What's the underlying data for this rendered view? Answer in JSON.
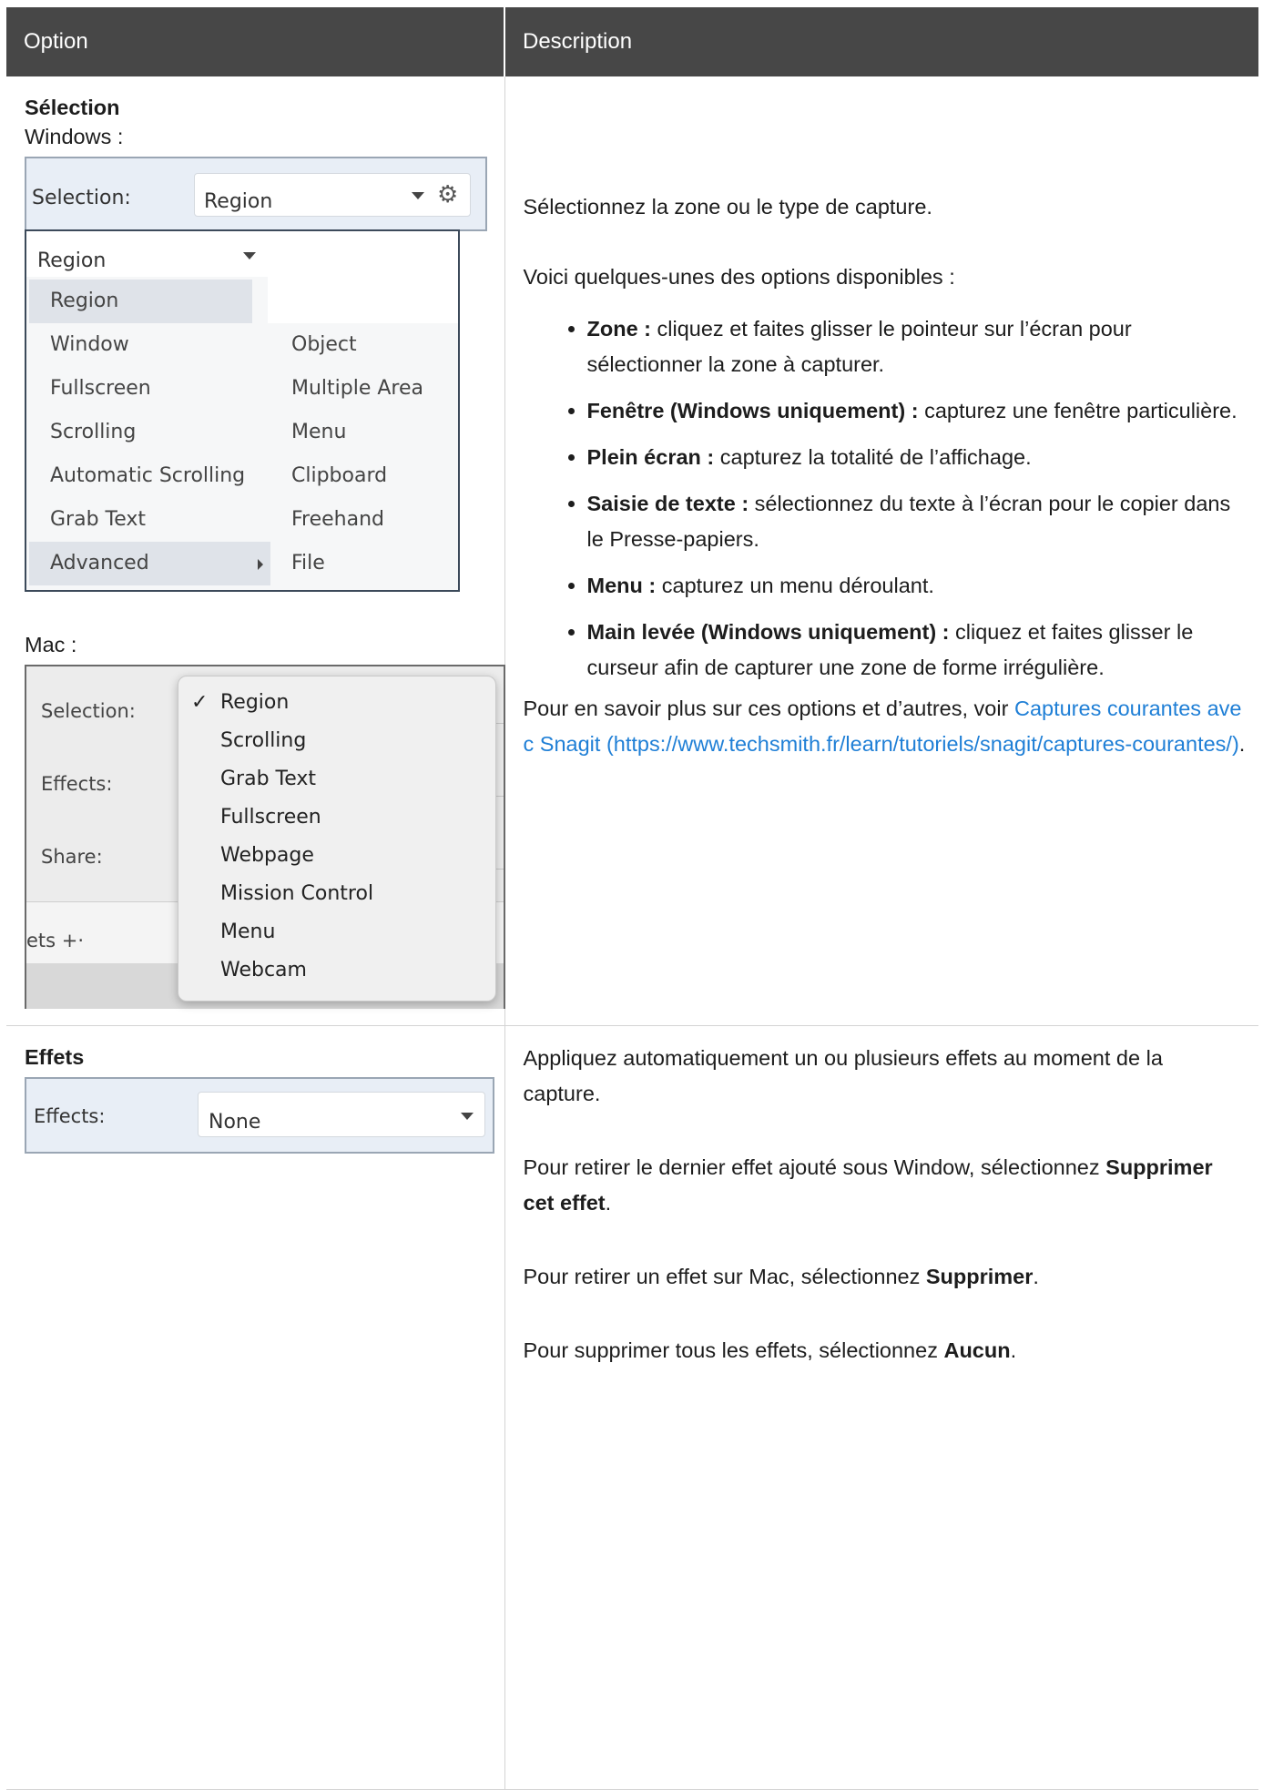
{
  "table": {
    "headers": {
      "option": "Option",
      "description": "Description"
    }
  },
  "selection_row": {
    "title": "Sélection",
    "windows_label": "Windows :",
    "mac_label": "Mac :",
    "windows_mock": {
      "bar_label": "Selection:",
      "combo_value": "Region",
      "dropdown_value": "Region",
      "menu_left": [
        "Region",
        "Window",
        "Fullscreen",
        "Scrolling",
        "Automatic Scrolling",
        "Grab Text",
        "Advanced"
      ],
      "menu_right": [
        "Object",
        "Multiple Area",
        "Menu",
        "Clipboard",
        "Freehand",
        "File"
      ]
    },
    "mac_mock": {
      "labels": {
        "selection": "Selection:",
        "effects": "Effects:",
        "share": "Share:",
        "footer": "ets  +·"
      },
      "checked_item": "Region",
      "menu_items": [
        "Region",
        "Scrolling",
        "Grab Text",
        "Fullscreen",
        "Webpage",
        "Mission Control",
        "Menu",
        "Webcam"
      ],
      "check_glyph": "✓"
    },
    "desc": {
      "p1": "Sélectionnez la zone ou le type de capture.",
      "p2": "Voici quelques-unes des options disponibles :",
      "bullets": [
        {
          "bold": "Zone :",
          "text": " cliquez et faites glisser le pointeur sur l’écran pour sélectionner la zone à capturer."
        },
        {
          "bold": "Fenêtre (Windows uniquement) :",
          "text": " capturez une fenêtre particulière."
        },
        {
          "bold": "Plein écran :",
          "text": " capturez la totalité de l’affichage."
        },
        {
          "bold": "Saisie de texte :",
          "text": " sélectionnez du texte à l’écran pour le copier dans le Presse-papiers."
        },
        {
          "bold": "Menu :",
          "text": " capturez un menu déroulant."
        },
        {
          "bold": "Main levée (Windows uniquement) :",
          "text": " cliquez et faites glisser le curseur afin de capturer une zone de forme irrégulière."
        }
      ],
      "more_prefix": "Pour en savoir plus sur ces options et d’autres, voir ",
      "link_text": "Captures courantes avec Snagit (https://www.techsmith.fr/learn/tutoriels/snagit/captures-courantes/)",
      "more_suffix": "."
    }
  },
  "effects_row": {
    "title": "Effets",
    "mock": {
      "label": "Effects:",
      "value": "None"
    },
    "desc": {
      "p1": "Appliquez automatiquement un ou plusieurs effets au moment de la capture.",
      "p2_prefix": "Pour retirer le dernier effet ajouté sous Window, sélectionnez ",
      "p2_bold": "Supprimer cet effet",
      "p2_suffix": ".",
      "p3_prefix": "Pour retirer un effet sur Mac, sélectionnez ",
      "p3_bold": "Supprimer",
      "p3_suffix": ".",
      "p4_prefix": "Pour supprimer tous les effets, sélectionnez ",
      "p4_bold": "Aucun",
      "p4_suffix": "."
    }
  },
  "colors": {
    "header_bg": "#474747",
    "link": "#1f7fd6",
    "mock_bar": "#e8eef6"
  },
  "icons": {
    "gear": "gear-icon",
    "caret": "chevron-down-icon",
    "submenu": "chevron-right-icon"
  }
}
